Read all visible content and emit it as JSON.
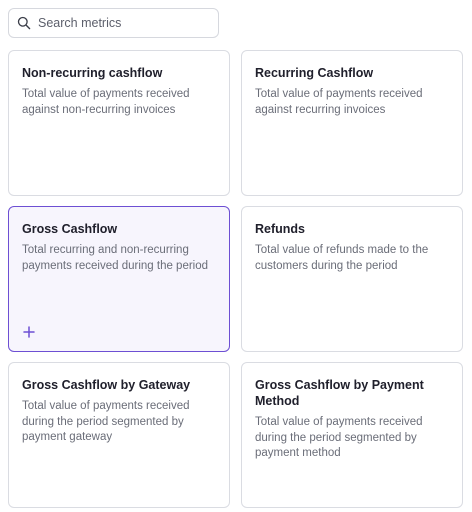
{
  "search": {
    "placeholder": "Search metrics",
    "value": ""
  },
  "metrics": [
    {
      "title": "Non-recurring cashflow",
      "description": "Total value of payments received against non-recurring invoices",
      "selected": false
    },
    {
      "title": "Recurring Cashflow",
      "description": "Total value of payments received against recurring invoices",
      "selected": false
    },
    {
      "title": "Gross Cashflow",
      "description": "Total recurring and non-recurring payments received during the period",
      "selected": true
    },
    {
      "title": "Refunds",
      "description": "Total value of refunds made to the customers during the period",
      "selected": false
    },
    {
      "title": "Gross Cashflow by Gateway",
      "description": "Total value of payments received during the period segmented by payment gateway",
      "selected": false
    },
    {
      "title": "Gross Cashflow by Payment Method",
      "description": "Total value of payments received during the period segmented by payment method",
      "selected": false
    }
  ],
  "icons": {
    "search": "search-icon",
    "add": "plus-icon"
  },
  "colors": {
    "accent": "#6d4fd3",
    "selected_background": "#f7f5fd"
  }
}
